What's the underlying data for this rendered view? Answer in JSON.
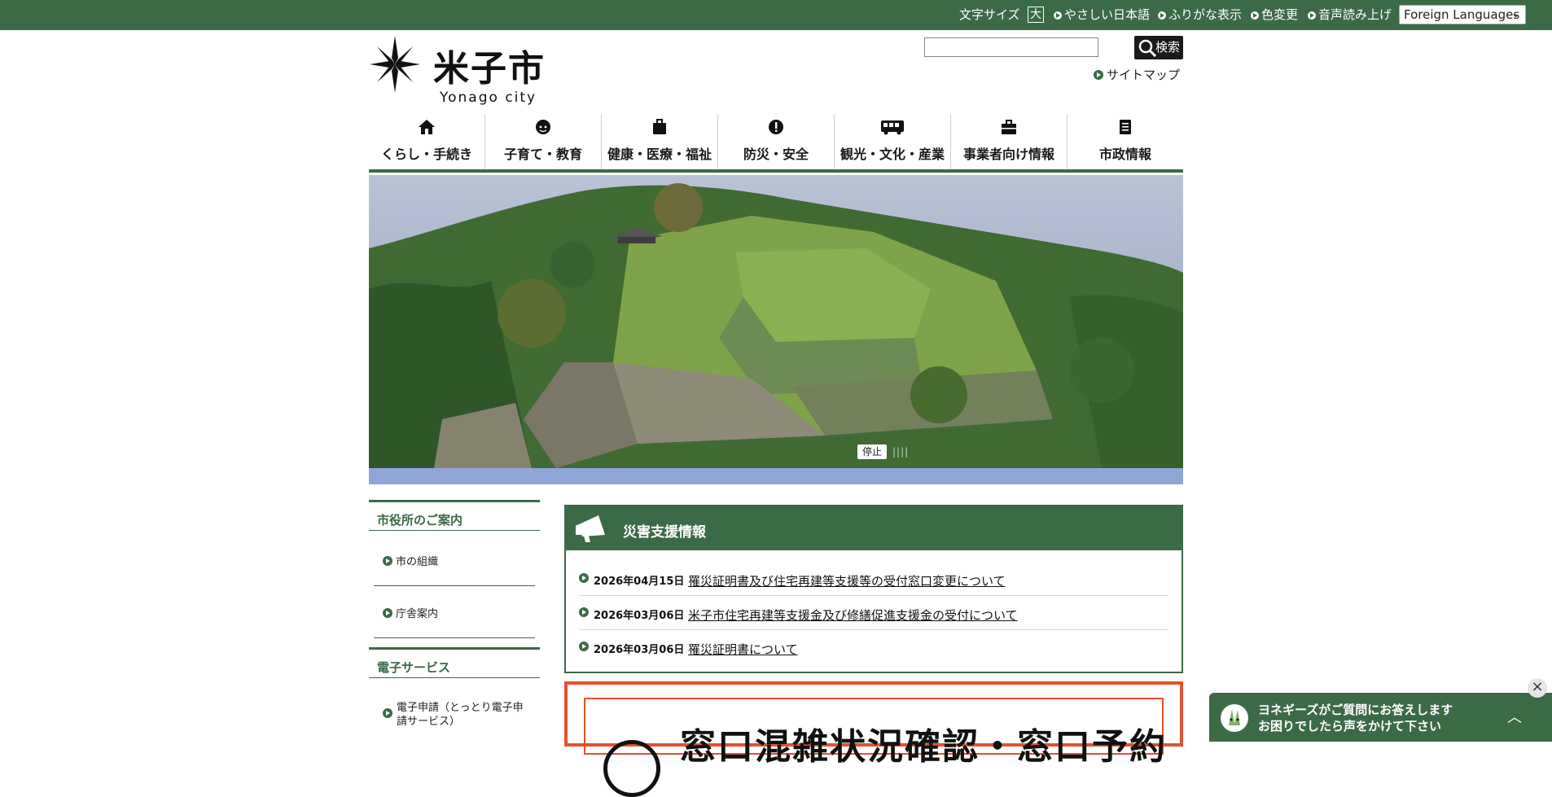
{
  "utility_bar": {
    "font_size_label": "文字サイズ",
    "font_size_button": "大",
    "links": [
      "やさしい日本語",
      "ふりがな表示",
      "色変更",
      "音声読み上げ"
    ],
    "language_select": "Foreign Languages"
  },
  "header": {
    "logo_title": "米子市",
    "logo_subtitle": "Yonago city",
    "search_value": "",
    "search_button": "検索",
    "sitemap": "サイトマップ"
  },
  "nav": {
    "items": [
      {
        "label": "くらし・手続き",
        "icon": "house-icon"
      },
      {
        "label": "子育て・教育",
        "icon": "child-icon"
      },
      {
        "label": "健康・医療・福祉",
        "icon": "medical-bag-icon"
      },
      {
        "label": "防災・安全",
        "icon": "alert-icon"
      },
      {
        "label": "観光・文化・産業",
        "icon": "bus-icon"
      },
      {
        "label": "事業者向け情報",
        "icon": "briefcase-icon"
      },
      {
        "label": "市政情報",
        "icon": "book-icon"
      }
    ]
  },
  "slideshow": {
    "stop_label": "停止",
    "pager": "||||"
  },
  "sidebar": {
    "sections": [
      {
        "heading": "市役所のご案内",
        "links": [
          "市の組織",
          "庁舎案内"
        ]
      },
      {
        "heading": "電子サービス",
        "links": [
          "電子申請（とっとり電子申",
          "請サービス）"
        ]
      }
    ]
  },
  "disaster": {
    "title": "災害支援情報",
    "items": [
      {
        "date": "2026年04月15日",
        "text": "罹災証明書及び住宅再建等支援等の受付窓口変更について"
      },
      {
        "date": "2026年03月06日",
        "text": "米子市住宅再建等支援金及び修繕促進支援金の受付について"
      },
      {
        "date": "2026年03月06日",
        "text": "罹災証明書について"
      }
    ]
  },
  "banner": {
    "text": "窓口混雑状況確認・窓口予約"
  },
  "chat": {
    "line1": "ヨネギーズがご質問にお答えします",
    "line2": "お困りでしたら声をかけて下さい",
    "toggle": "︿",
    "close": "×"
  },
  "colors": {
    "brand_green": "#3b6a47",
    "banner_red": "#e2522e"
  }
}
